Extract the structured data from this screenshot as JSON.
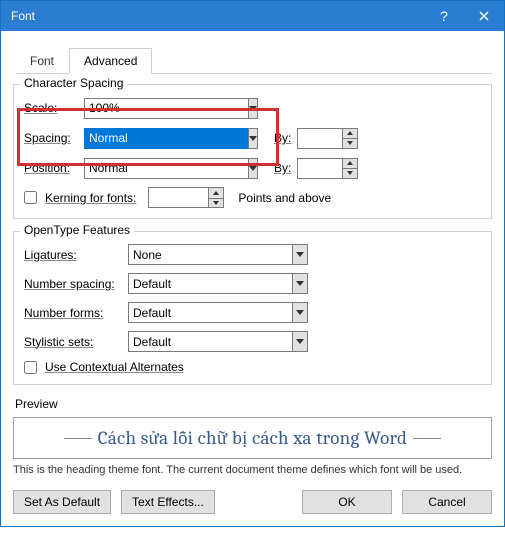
{
  "title": "Font",
  "tabs": {
    "font": "Font",
    "advanced": "Advanced"
  },
  "cs": {
    "legend": "Character Spacing",
    "scale_lbl": "Scale:",
    "scale_val": "100%",
    "spacing_lbl": "Spacing:",
    "spacing_val": "Normal",
    "by1": "By:",
    "by1_val": "",
    "position_lbl": "Position:",
    "position_val": "Normal",
    "by2": "By:",
    "by2_val": "",
    "kerning": "Kerning for fonts:",
    "kerning_val": "",
    "points_above": "Points and above"
  },
  "ot": {
    "legend": "OpenType Features",
    "lig_lbl": "Ligatures:",
    "lig_val": "None",
    "numsp_lbl": "Number spacing:",
    "numsp_val": "Default",
    "numfm_lbl": "Number forms:",
    "numfm_val": "Default",
    "sty_lbl": "Stylistic sets:",
    "sty_val": "Default",
    "ctx": "Use Contextual Alternates"
  },
  "preview": {
    "label": "Preview",
    "text": "Cách sửa lỗi chữ bị cách xa trong Word",
    "desc": "This is the heading theme font. The current document theme defines which font will be used."
  },
  "footer": {
    "setdefault": "Set As Default",
    "texteffects": "Text Effects...",
    "ok": "OK",
    "cancel": "Cancel"
  }
}
